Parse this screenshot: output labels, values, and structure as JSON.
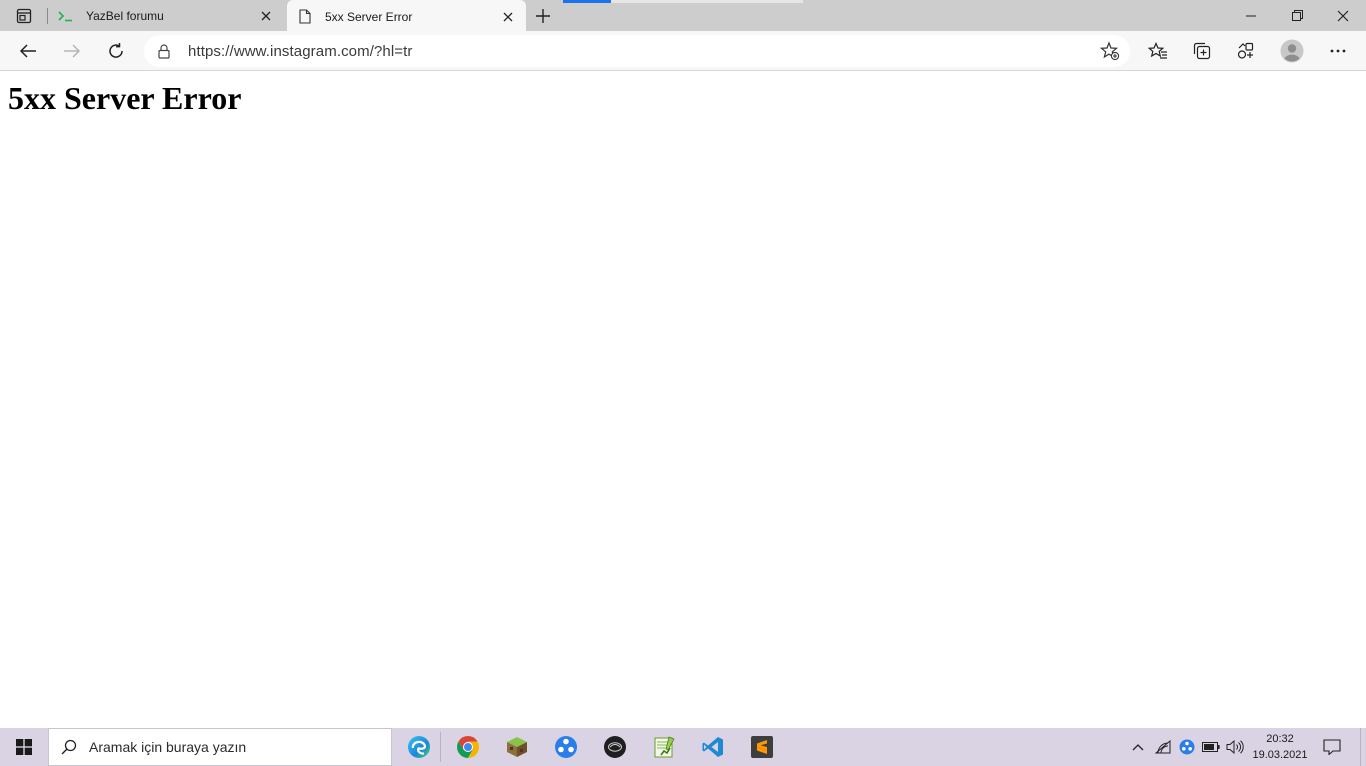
{
  "browser": {
    "tabs": [
      {
        "title": "YazBel forumu",
        "favicon": "terminal-prompt-icon",
        "active": false
      },
      {
        "title": "5xx Server Error",
        "favicon": "page-icon",
        "active": true
      }
    ],
    "address_bar": {
      "url": "https://www.instagram.com/?hl=tr"
    },
    "accent_color": "#1a73e8"
  },
  "page": {
    "heading": "5xx Server Error"
  },
  "taskbar": {
    "search_placeholder": "Aramak için buraya yazın",
    "pinned_apps": [
      "edge-icon",
      "chrome-icon",
      "minecraft-icon",
      "blue-dots-app-icon",
      "dark-circle-app-icon",
      "notepad-plus-icon",
      "vscode-icon",
      "sublime-text-icon"
    ],
    "clock": {
      "time": "20:32",
      "date": "19.03.2021"
    }
  }
}
